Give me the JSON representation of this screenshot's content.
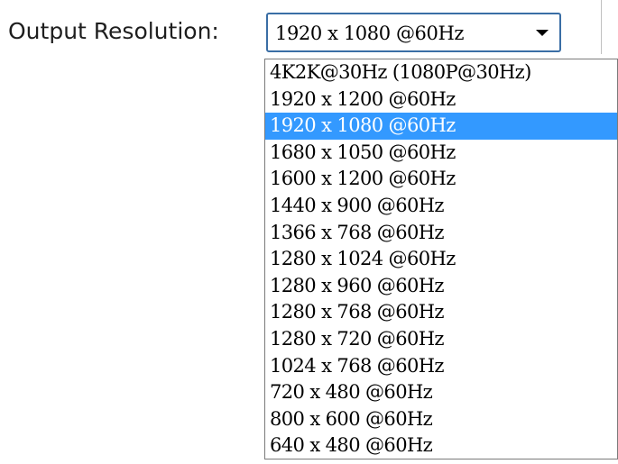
{
  "label": "Output Resolution:",
  "selected_value": "1920 x 1080 @60Hz",
  "dropdown_icon": "chevron-down-icon",
  "options": [
    "4K2K@30Hz (1080P@30Hz)",
    "1920 x 1200 @60Hz",
    "1920 x 1080 @60Hz",
    "1680 x 1050 @60Hz",
    "1600 x 1200 @60Hz",
    "1440 x 900 @60Hz",
    "1366 x 768 @60Hz",
    "1280 x 1024 @60Hz",
    "1280 x 960 @60Hz",
    "1280 x 768 @60Hz",
    "1280 x 720 @60Hz",
    "1024 x 768 @60Hz",
    "720 x 480 @60Hz",
    "800 x 600 @60Hz",
    "640 x 480 @60Hz"
  ],
  "highlighted_index": 2,
  "colors": {
    "highlight": "#3399ff",
    "highlight_text": "#ffffff",
    "combo_border": "#3a6ea5"
  }
}
